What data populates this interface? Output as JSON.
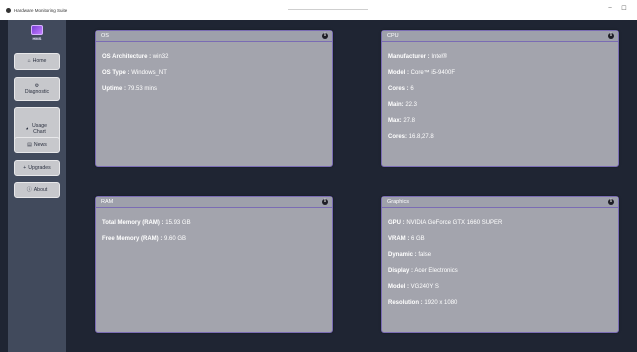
{
  "window": {
    "title": "Hardware Monitoring Suite",
    "minimize": "–",
    "maximize": "☐"
  },
  "sidebar": {
    "logo_text": "HMS",
    "items": [
      {
        "label": "Home",
        "icon": "home-icon",
        "glyph": "⌂"
      },
      {
        "label": "Diagnostic",
        "icon": "diagnostic-icon",
        "glyph": "⚙"
      },
      {
        "label": "Usage Chart",
        "icon": "chart-icon",
        "glyph": "◕"
      },
      {
        "label": "News",
        "icon": "news-icon",
        "glyph": "▤"
      },
      {
        "label": "Upgrades",
        "icon": "upgrades-icon",
        "glyph": "+"
      },
      {
        "label": "About",
        "icon": "about-icon",
        "glyph": "ⓘ"
      }
    ]
  },
  "cards": {
    "os": {
      "title": "OS",
      "rows": [
        {
          "key": "OS Architecture :",
          "value": " win32"
        },
        {
          "key": "OS Type :",
          "value": " Windows_NT"
        },
        {
          "key": "Uptime :",
          "value": " 79.53 mins"
        }
      ]
    },
    "cpu": {
      "title": "CPU",
      "rows": [
        {
          "key": "Manufacturer :",
          "value": " Intel®"
        },
        {
          "key": "Model :",
          "value": " Core™ i5-9400F"
        },
        {
          "key": "Cores :",
          "value": " 6"
        },
        {
          "key": "Main:",
          "value": " 22.3"
        },
        {
          "key": "Max:",
          "value": " 27.8"
        },
        {
          "key": "Cores:",
          "value": " 16.8,27.8"
        }
      ]
    },
    "ram": {
      "title": "RAM",
      "rows": [
        {
          "key": "Total Memory (RAM) :",
          "value": " 15.93 GB"
        },
        {
          "key": "Free Memory (RAM) :",
          "value": " 9.60 GB"
        }
      ]
    },
    "graphics": {
      "title": "Graphics",
      "rows": [
        {
          "key": "GPU :",
          "value": " NVIDIA GeForce GTX 1660 SUPER"
        },
        {
          "key": "VRAM :",
          "value": " 6 GB"
        },
        {
          "key": "Dynamic :",
          "value": " false"
        },
        {
          "key": "Display :",
          "value": " Acer Electronics"
        },
        {
          "key": "Model :",
          "value": " VG240Y S"
        },
        {
          "key": "Resolution :",
          "value": " 1920 x 1080"
        }
      ]
    }
  },
  "colors": {
    "background": "#1f2533",
    "sidebar": "#414a5c",
    "card": "#a3a4ad",
    "card_border": "#7a6cb4"
  }
}
